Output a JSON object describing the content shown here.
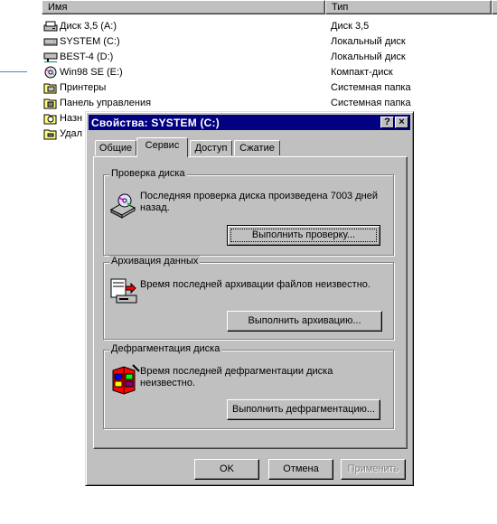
{
  "explorer": {
    "columns": {
      "name": "Имя",
      "type": "Тип"
    },
    "rows": [
      {
        "name": "Диск 3,5 (A:)",
        "type": "Диск 3,5",
        "icon": "floppy-drive-icon"
      },
      {
        "name": "SYSTEM (C:)",
        "type": "Локальный диск",
        "icon": "hard-drive-icon"
      },
      {
        "name": "BEST-4 (D:)",
        "type": "Локальный диск",
        "icon": "hard-drive-icon"
      },
      {
        "name": "Win98 SE (E:)",
        "type": "Компакт-диск",
        "icon": "cd-drive-icon"
      },
      {
        "name": "Принтеры",
        "type": "Системная папка",
        "icon": "printers-folder-icon"
      },
      {
        "name": "Панель управления",
        "type": "Системная папка",
        "icon": "control-panel-folder-icon"
      },
      {
        "name": "Назн",
        "type": "",
        "icon": "scheduled-tasks-folder-icon"
      },
      {
        "name": "Удал",
        "type": "",
        "icon": "dialup-folder-icon"
      }
    ]
  },
  "dialog": {
    "title": "Свойства: SYSTEM (C:)",
    "help_glyph": "?",
    "close_glyph": "×",
    "tabs": [
      "Общие",
      "Сервис",
      "Доступ",
      "Сжатие"
    ],
    "active_tab": "Сервис",
    "groups": {
      "check": {
        "legend": "Проверка диска",
        "text": "Последняя проверка диска произведена 7003 дней назад.",
        "button": "Выполнить проверку..."
      },
      "backup": {
        "legend": "Архивация данных",
        "text": "Время последней архивации файлов неизвестно.",
        "button": "Выполнить архивацию..."
      },
      "defrag": {
        "legend": "Дефрагментация диска",
        "text": "Время последней дефрагментации диска неизвестно.",
        "button": "Выполнить дефрагментацию..."
      }
    },
    "buttons": {
      "ok": "OK",
      "cancel": "Отмена",
      "apply": "Применить"
    }
  },
  "colors": {
    "face": "#c0c0c0",
    "title_bar": "#000080",
    "window": "#ffffff"
  }
}
